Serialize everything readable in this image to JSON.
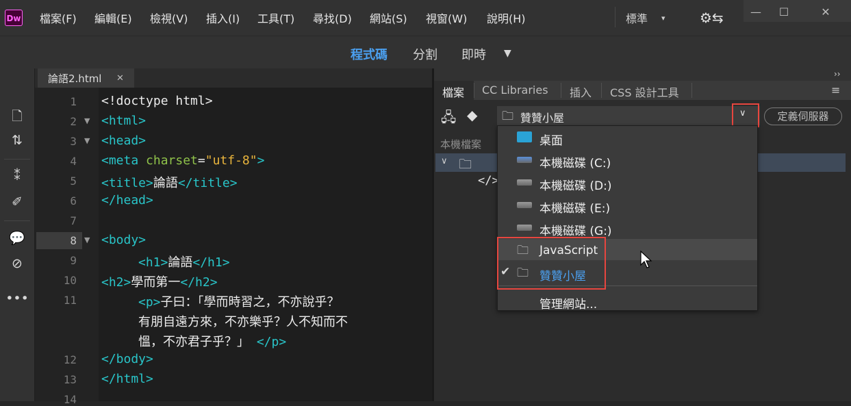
{
  "app": {
    "logo": "Dw"
  },
  "menu": [
    "檔案(F)",
    "編輯(E)",
    "檢視(V)",
    "插入(I)",
    "工具(T)",
    "尋找(D)",
    "網站(S)",
    "視窗(W)",
    "說明(H)"
  ],
  "workspace": "標準",
  "view_modes": {
    "code": "程式碼",
    "split": "分割",
    "live": "即時"
  },
  "document_tab": {
    "label": "論語2.html"
  },
  "code_lines": [
    {
      "n": "1",
      "text": "<!doctype html>"
    },
    {
      "n": "2",
      "text": "<html>"
    },
    {
      "n": "3",
      "text": "<head>"
    },
    {
      "n": "4",
      "tag_open": "<meta ",
      "attr": "charset",
      "eq": "=",
      "str": "\"utf-8\"",
      "tag_close": ">"
    },
    {
      "n": "5",
      "tag_open": "<title>",
      "content": "論語",
      "tag_close": "</title>"
    },
    {
      "n": "6",
      "text": "</head>"
    },
    {
      "n": "7",
      "text": ""
    },
    {
      "n": "8",
      "text": "<body>"
    },
    {
      "n": "9",
      "tag_open": "<h1>",
      "content": "論語",
      "tag_close": "</h1>"
    },
    {
      "n": "10",
      "tag_open": "<h2>",
      "content": "學而第一",
      "tag_close": "</h2>"
    },
    {
      "n": "11",
      "tag_open": "<p>",
      "content_lines": [
        "子曰：「學而時習之，不亦說乎？",
        "有朋自遠方來，不亦樂乎？人不知而不",
        "慍，不亦君子乎？」"
      ],
      "tag_close": "</p>"
    },
    {
      "n": "12",
      "text": "</body>"
    },
    {
      "n": "13",
      "text": "</html>"
    },
    {
      "n": "14",
      "text": ""
    }
  ],
  "panel": {
    "tabs": [
      "檔案",
      "CC Libraries",
      "插入",
      "CSS 設計工具"
    ],
    "site_select": "贊贊小屋",
    "define_server": "定義伺服器",
    "local_files": "本機檔案",
    "tree_code_icon": "</>"
  },
  "dropdown": {
    "items": [
      {
        "label": "桌面",
        "icon": "desktop-icon"
      },
      {
        "label": "本機磁碟 (C:)",
        "icon": "system-drive-icon"
      },
      {
        "label": "本機磁碟 (D:)",
        "icon": "drive-icon"
      },
      {
        "label": "本機磁碟 (E:)",
        "icon": "drive-icon"
      },
      {
        "label": "本機磁碟 (G:)",
        "icon": "drive-icon"
      },
      {
        "label": "JavaScript",
        "icon": "folder-icon"
      },
      {
        "label": "贊贊小屋",
        "icon": "folder-icon",
        "selected": true
      }
    ],
    "manage_sites": "管理網站..."
  },
  "colors": {
    "accent": "#4ba0f0",
    "highlight_box": "#e8463f",
    "tag": "#29c5c9",
    "attr": "#8fc24a",
    "string": "#e8b43c"
  }
}
